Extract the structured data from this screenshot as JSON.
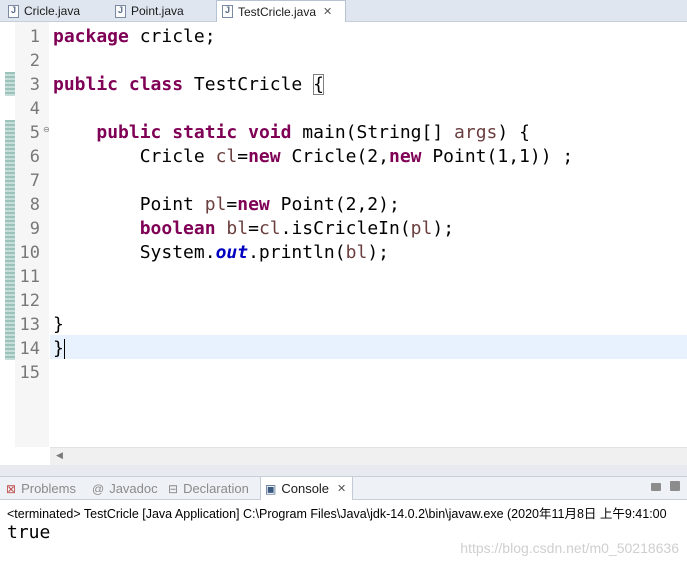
{
  "editor_tabs": [
    {
      "label": "Cricle.java",
      "active": false,
      "icon": "java-file-icon"
    },
    {
      "label": "Point.java",
      "active": false,
      "icon": "java-file-icon"
    },
    {
      "label": "TestCricle.java",
      "active": true,
      "icon": "java-file-icon",
      "close": "✕"
    }
  ],
  "line_numbers": [
    "1",
    "2",
    "3",
    "4",
    "5",
    "6",
    "7",
    "8",
    "9",
    "10",
    "11",
    "12",
    "13",
    "14",
    "15"
  ],
  "code_lines": [
    {
      "n": 1,
      "tokens": [
        {
          "t": "package",
          "c": "kw"
        },
        {
          "t": " cricle;"
        }
      ]
    },
    {
      "n": 2,
      "tokens": []
    },
    {
      "n": 3,
      "tokens": [
        {
          "t": "public",
          "c": "kw"
        },
        {
          "t": " "
        },
        {
          "t": "class",
          "c": "kw"
        },
        {
          "t": " TestCricle "
        },
        {
          "t": "{",
          "c": "bracket-box"
        }
      ]
    },
    {
      "n": 4,
      "tokens": []
    },
    {
      "n": 5,
      "tokens": [
        {
          "t": "    "
        },
        {
          "t": "public",
          "c": "kw"
        },
        {
          "t": " "
        },
        {
          "t": "static",
          "c": "kw"
        },
        {
          "t": " "
        },
        {
          "t": "void",
          "c": "kw"
        },
        {
          "t": " main(String[] "
        },
        {
          "t": "args",
          "c": "var"
        },
        {
          "t": ") {"
        }
      ]
    },
    {
      "n": 6,
      "tokens": [
        {
          "t": "        Cricle "
        },
        {
          "t": "cl",
          "c": "var"
        },
        {
          "t": "="
        },
        {
          "t": "new",
          "c": "kw"
        },
        {
          "t": " Cricle(2,"
        },
        {
          "t": "new",
          "c": "kw"
        },
        {
          "t": " Point(1,1)) ;"
        }
      ]
    },
    {
      "n": 7,
      "tokens": []
    },
    {
      "n": 8,
      "tokens": [
        {
          "t": "        Point "
        },
        {
          "t": "pl",
          "c": "var"
        },
        {
          "t": "="
        },
        {
          "t": "new",
          "c": "kw"
        },
        {
          "t": " Point(2,2);"
        }
      ]
    },
    {
      "n": 9,
      "tokens": [
        {
          "t": "        "
        },
        {
          "t": "boolean",
          "c": "kw"
        },
        {
          "t": " "
        },
        {
          "t": "bl",
          "c": "var"
        },
        {
          "t": "="
        },
        {
          "t": "cl",
          "c": "var"
        },
        {
          "t": ".isCricleIn("
        },
        {
          "t": "pl",
          "c": "var"
        },
        {
          "t": ");"
        }
      ]
    },
    {
      "n": 10,
      "tokens": [
        {
          "t": "        System."
        },
        {
          "t": "out",
          "c": "fld"
        },
        {
          "t": ".println("
        },
        {
          "t": "bl",
          "c": "var"
        },
        {
          "t": ");"
        }
      ]
    },
    {
      "n": 11,
      "tokens": []
    },
    {
      "n": 12,
      "tokens": []
    },
    {
      "n": 13,
      "tokens": [
        {
          "t": "}"
        }
      ]
    },
    {
      "n": 14,
      "tokens": [
        {
          "t": "}"
        },
        {
          "caret": true
        }
      ]
    },
    {
      "n": 15,
      "tokens": []
    }
  ],
  "fold_marker": "⊖",
  "hscroll_arrow": "◀",
  "panel_tabs": [
    {
      "label": "Problems",
      "icon": "problems-icon",
      "glyph": "⊠",
      "active": false
    },
    {
      "label": "Javadoc",
      "icon": "javadoc-icon",
      "glyph": "@",
      "active": false
    },
    {
      "label": "Declaration",
      "icon": "declaration-icon",
      "glyph": "⊟",
      "active": false
    },
    {
      "label": "Console",
      "icon": "console-icon",
      "glyph": "▣",
      "active": true,
      "close": "✕"
    }
  ],
  "console": {
    "header": "<terminated> TestCricle [Java Application] C:\\Program Files\\Java\\jdk-14.0.2\\bin\\javaw.exe (2020年11月8日 上午9:41:00",
    "output": "true"
  },
  "watermark": "https://blog.csdn.net/m0_50218636",
  "colors": {
    "keyword": "#7f0055",
    "local_variable": "#6a3e3e",
    "static_field": "#0000c0",
    "current_line": "#e8f2fe"
  }
}
